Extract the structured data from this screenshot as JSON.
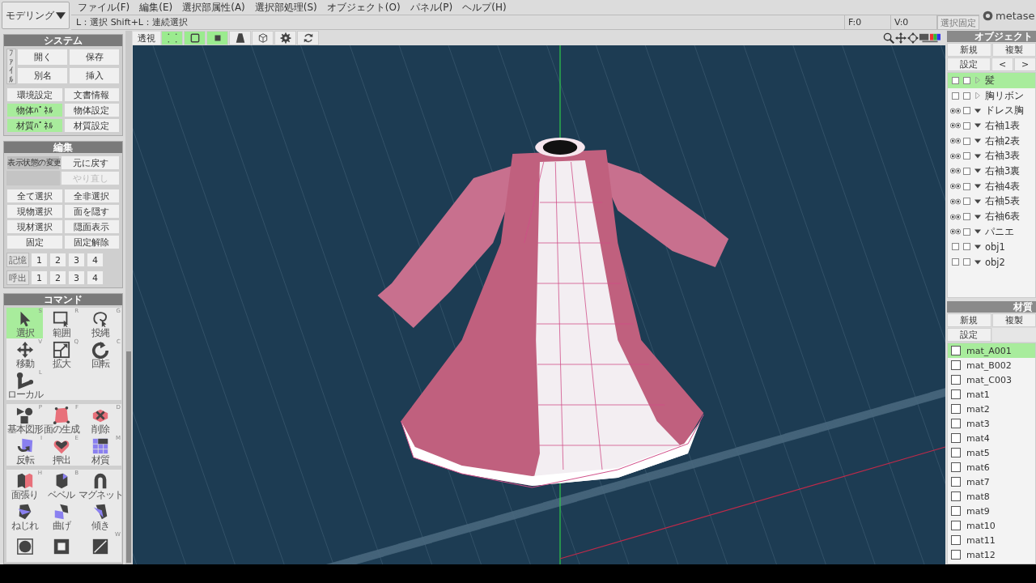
{
  "mode_dropdown": {
    "value": "モデリング"
  },
  "menu": [
    "ファイル(F)",
    "編集(E)",
    "選択部属性(A)",
    "選択部処理(S)",
    "オブジェクト(O)",
    "パネル(P)",
    "ヘルプ(H)"
  ],
  "hint": "L：選択  Shift+L：連続選択",
  "status": {
    "faces": "F:0",
    "vertices": "V:0",
    "lock_button": "選択固定"
  },
  "logo": {
    "text": "metase"
  },
  "toolbar": {
    "perspective_label": "透視",
    "buttons": [
      {
        "kind": "vertex",
        "selected": true
      },
      {
        "kind": "edge",
        "selected": true
      },
      {
        "kind": "face",
        "selected": true
      },
      {
        "kind": "trapezoid",
        "selected": false
      },
      {
        "kind": "wirecube",
        "selected": false
      },
      {
        "kind": "gear",
        "selected": false
      },
      {
        "kind": "refresh",
        "selected": false
      }
    ]
  },
  "system": {
    "title": "システム",
    "file_tab": "ﾌｧｲﾙ",
    "file_buttons": [
      "開く",
      "保存",
      "別名",
      "挿入"
    ],
    "buttons": [
      {
        "label": "環境設定",
        "selected": false
      },
      {
        "label": "文書情報",
        "selected": false
      },
      {
        "label": "物体ﾊﾟﾈﾙ",
        "selected": true
      },
      {
        "label": "物体設定",
        "selected": false
      },
      {
        "label": "材質ﾊﾟﾈﾙ",
        "selected": true
      },
      {
        "label": "材質設定",
        "selected": false
      }
    ]
  },
  "edit": {
    "title": "編集",
    "display_state": "表示状態の変更",
    "history": [
      {
        "label": "元に戻す",
        "disabled": false
      },
      {
        "label": "やり直し",
        "disabled": true
      }
    ],
    "buttons": [
      "全て選択",
      "全非選択",
      "現物選択",
      "面を隠す",
      "現材選択",
      "隠面表示",
      "固定",
      "固定解除"
    ],
    "memory": [
      {
        "label": "記憶",
        "slots": [
          "1",
          "2",
          "3",
          "4"
        ]
      },
      {
        "label": "呼出",
        "slots": [
          "1",
          "2",
          "3",
          "4"
        ]
      }
    ]
  },
  "command": {
    "title": "コマンド",
    "groups": [
      {
        "tools": [
          {
            "kind": "select",
            "label": "選択",
            "key": "S",
            "selected": true
          },
          {
            "kind": "range",
            "label": "範囲",
            "key": "R",
            "selected": false
          },
          {
            "kind": "lasso",
            "label": "投縄",
            "key": "G",
            "selected": false
          },
          {
            "kind": "move",
            "label": "移動",
            "key": "V",
            "selected": false
          },
          {
            "kind": "scale",
            "label": "拡大",
            "key": "Q",
            "selected": false
          },
          {
            "kind": "rotate",
            "label": "回転",
            "key": "C",
            "selected": false
          },
          {
            "kind": "local",
            "label": "ローカル",
            "key": "L",
            "selected": false
          }
        ]
      },
      {
        "tools": [
          {
            "kind": "primitive",
            "label": "基本図形",
            "key": "P",
            "selected": false
          },
          {
            "kind": "face",
            "label": "面の生成",
            "key": "F",
            "selected": false
          },
          {
            "kind": "delete",
            "label": "削除",
            "key": "D",
            "selected": false
          },
          {
            "kind": "flip",
            "label": "反転",
            "key": "I",
            "selected": false
          },
          {
            "kind": "extrude",
            "label": "押出",
            "key": "E",
            "selected": false
          },
          {
            "kind": "material",
            "label": "材質",
            "key": "M",
            "selected": false
          }
        ]
      },
      {
        "tools": [
          {
            "kind": "facefill",
            "label": "面張り",
            "key": "H",
            "selected": false
          },
          {
            "kind": "bevel",
            "label": "ベベル",
            "key": "B",
            "selected": false
          },
          {
            "kind": "magnet",
            "label": "マグネット",
            "selected": false
          },
          {
            "kind": "twist",
            "label": "ねじれ",
            "selected": false
          },
          {
            "kind": "bend",
            "label": "曲げ",
            "selected": false
          },
          {
            "kind": "tilt",
            "label": "傾き",
            "selected": false
          },
          {
            "kind": "spherebox",
            "selected": false
          },
          {
            "kind": "frame",
            "selected": false
          },
          {
            "kind": "diagonal",
            "key": "W",
            "selected": false
          }
        ]
      }
    ]
  },
  "objects": {
    "title": "オブジェクト",
    "buttons": [
      "新規",
      "複製",
      "設定",
      "<",
      ">"
    ],
    "items": [
      {
        "name": "髪",
        "visible": false,
        "expanded": false,
        "selected": true
      },
      {
        "name": "胸リボン",
        "visible": false,
        "expanded": false,
        "selected": false
      },
      {
        "name": "ドレス胸",
        "visible": true,
        "expanded": true,
        "selected": false
      },
      {
        "name": "右袖1表",
        "visible": true,
        "expanded": true,
        "selected": false
      },
      {
        "name": "右袖2表",
        "visible": true,
        "expanded": true,
        "selected": false
      },
      {
        "name": "右袖3表",
        "visible": true,
        "expanded": true,
        "selected": false
      },
      {
        "name": "右袖3裏",
        "visible": true,
        "expanded": true,
        "selected": false
      },
      {
        "name": "右袖4表",
        "visible": true,
        "expanded": true,
        "selected": false
      },
      {
        "name": "右袖5表",
        "visible": true,
        "expanded": true,
        "selected": false
      },
      {
        "name": "右袖6表",
        "visible": true,
        "expanded": true,
        "selected": false
      },
      {
        "name": "パニエ",
        "visible": true,
        "expanded": true,
        "selected": false
      },
      {
        "name": "obj1",
        "visible": false,
        "expanded": true,
        "selected": false
      },
      {
        "name": "obj2",
        "visible": false,
        "expanded": true,
        "selected": false
      }
    ]
  },
  "materials": {
    "title": "材質",
    "buttons": [
      "新規",
      "複製",
      "設定"
    ],
    "items": [
      {
        "name": "mat_A001",
        "selected": true
      },
      {
        "name": "mat_B002",
        "selected": false
      },
      {
        "name": "mat_C003",
        "selected": false
      },
      {
        "name": "mat1",
        "selected": false
      },
      {
        "name": "mat2",
        "selected": false
      },
      {
        "name": "mat3",
        "selected": false
      },
      {
        "name": "mat4",
        "selected": false
      },
      {
        "name": "mat5",
        "selected": false
      },
      {
        "name": "mat6",
        "selected": false
      },
      {
        "name": "mat7",
        "selected": false
      },
      {
        "name": "mat8",
        "selected": false
      },
      {
        "name": "mat9",
        "selected": false
      },
      {
        "name": "mat10",
        "selected": false
      },
      {
        "name": "mat11",
        "selected": false
      },
      {
        "name": "mat12",
        "selected": false
      }
    ]
  }
}
